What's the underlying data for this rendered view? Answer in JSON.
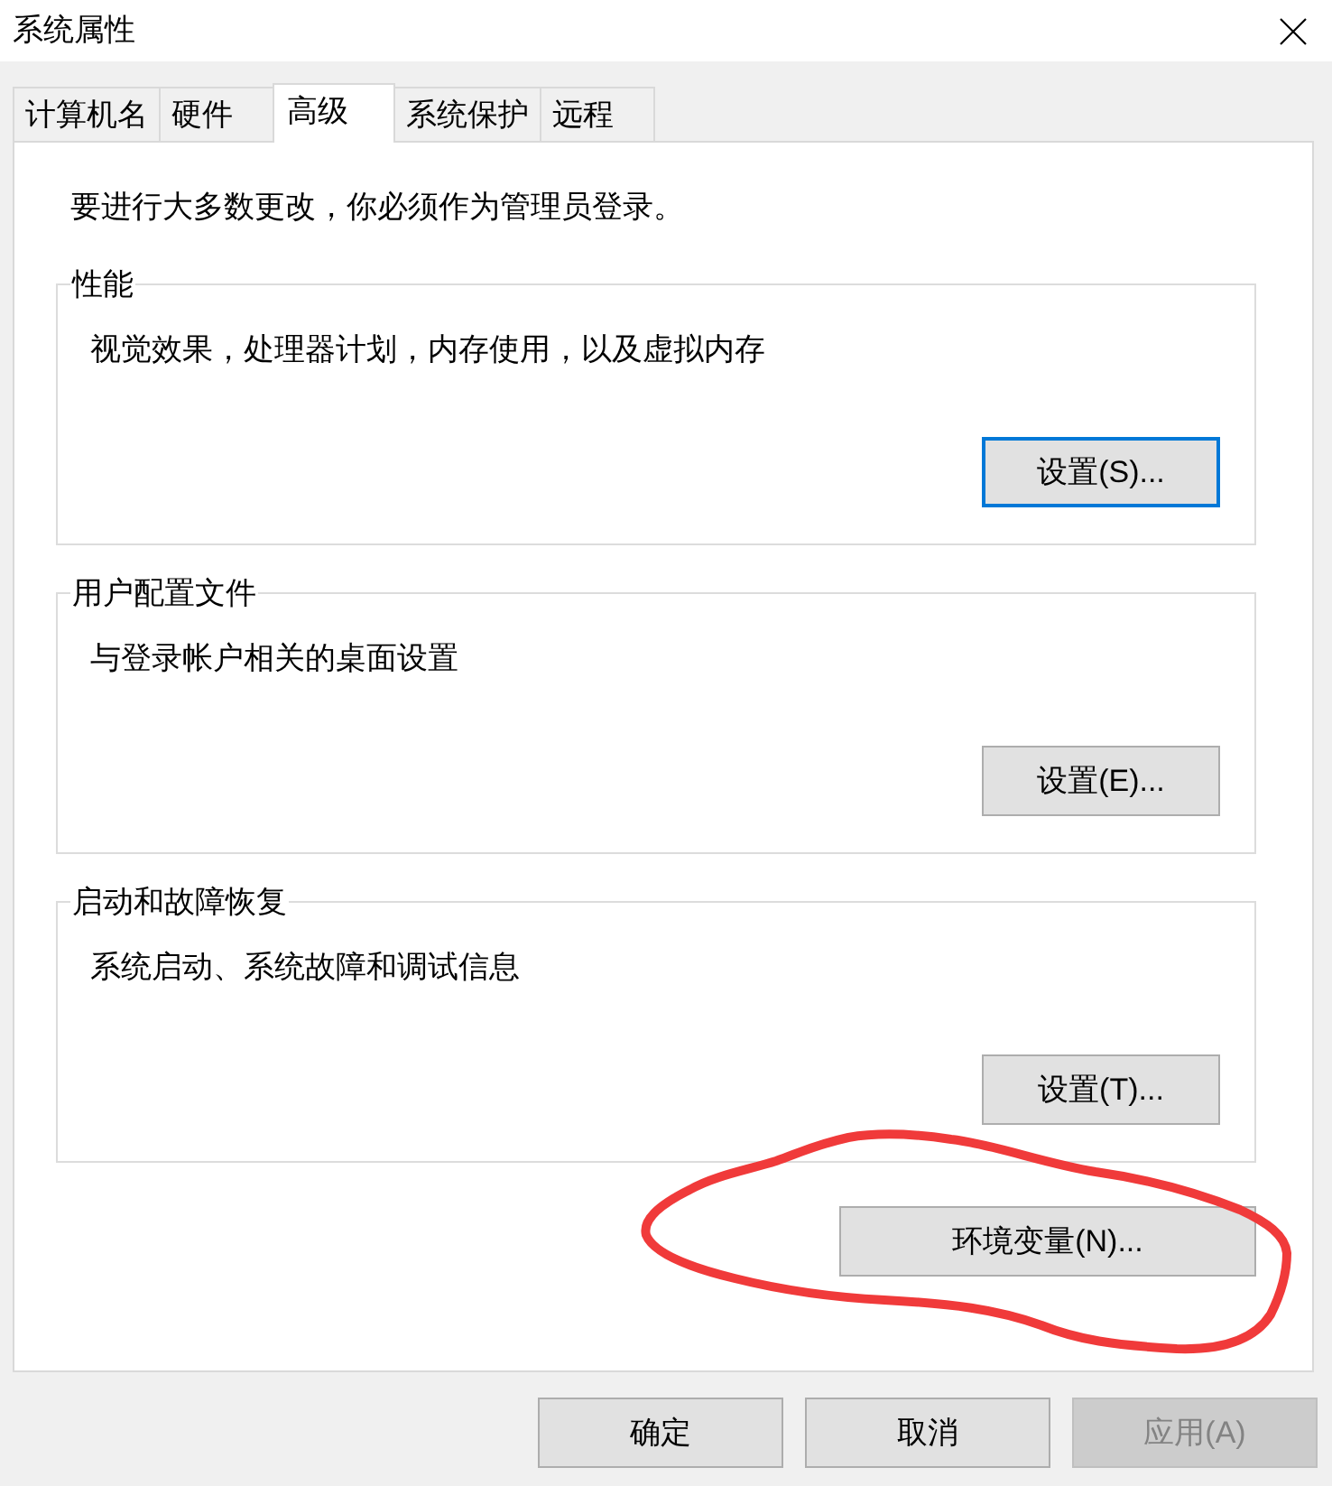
{
  "window": {
    "title": "系统属性"
  },
  "tabs": [
    {
      "label": "计算机名",
      "selected": false
    },
    {
      "label": "硬件",
      "selected": false
    },
    {
      "label": "高级",
      "selected": true
    },
    {
      "label": "系统保护",
      "selected": false
    },
    {
      "label": "远程",
      "selected": false
    }
  ],
  "notice": "要进行大多数更改，你必须作为管理员登录。",
  "groups": [
    {
      "title": "性能",
      "description": "视觉效果，处理器计划，内存使用，以及虚拟内存",
      "button": {
        "label": "设置(S)...",
        "focused": true
      }
    },
    {
      "title": "用户配置文件",
      "description": "与登录帐户相关的桌面设置",
      "button": {
        "label": "设置(E)...",
        "focused": false
      }
    },
    {
      "title": "启动和故障恢复",
      "description": "系统启动、系统故障和调试信息",
      "button": {
        "label": "设置(T)...",
        "focused": false
      }
    }
  ],
  "environment_button": {
    "label": "环境变量(N)...",
    "circled": true
  },
  "buttons": [
    {
      "label": "确定",
      "disabled": false
    },
    {
      "label": "取消",
      "disabled": false
    },
    {
      "label": "应用(A)",
      "disabled": true
    }
  ]
}
